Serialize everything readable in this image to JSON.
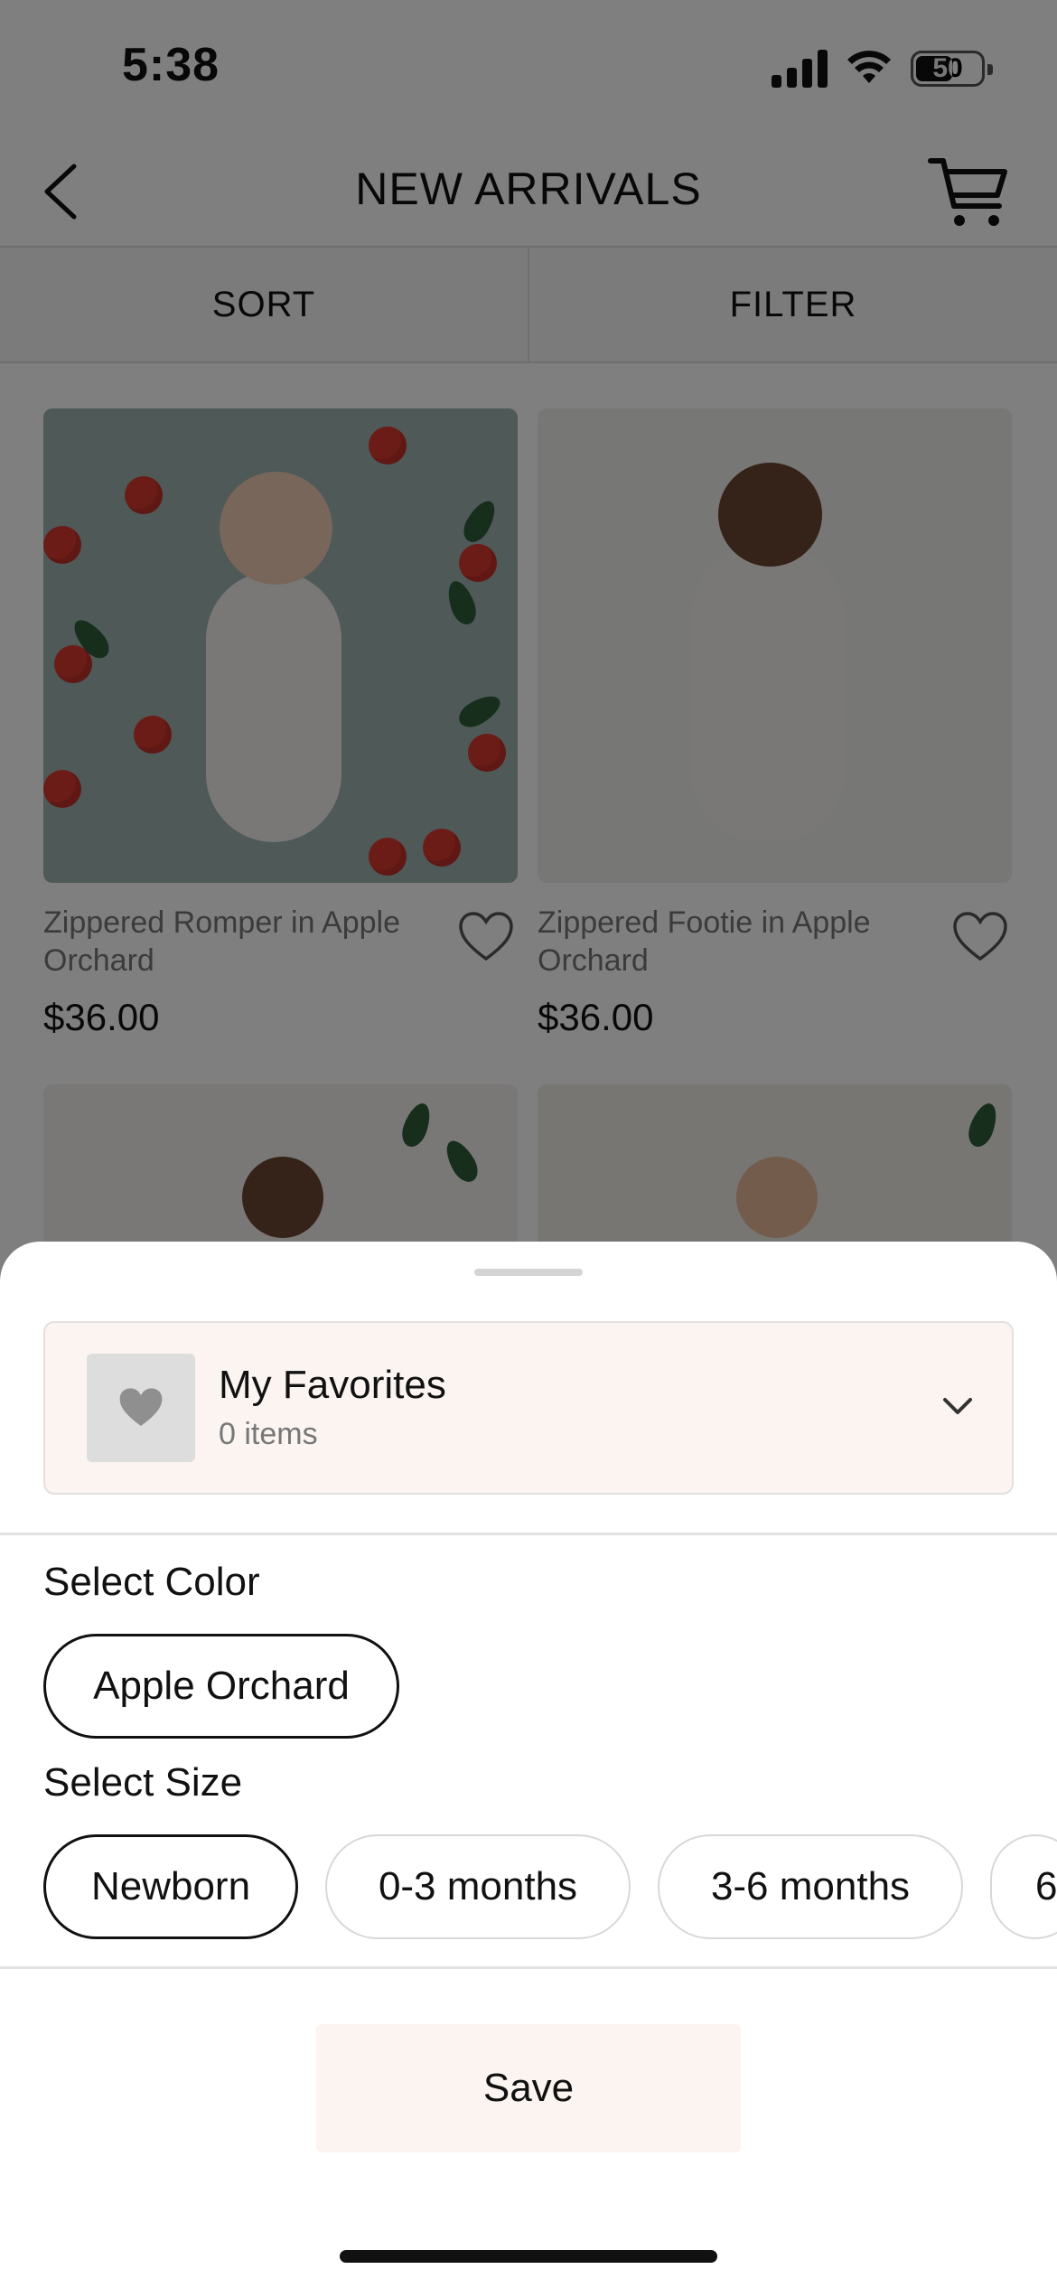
{
  "status_bar": {
    "time": "5:38",
    "battery": "50",
    "icons": [
      "signal-icon",
      "wifi-icon",
      "battery-icon"
    ]
  },
  "header": {
    "title": "NEW ARRIVALS",
    "back_icon": "back-chevron-icon",
    "cart_icon": "cart-icon"
  },
  "toolbar": {
    "sort_label": "SORT",
    "filter_label": "FILTER"
  },
  "products": [
    {
      "name": "Zippered Romper in Apple Orchard",
      "price": "$36.00",
      "favorite_icon": "heart-outline-icon"
    },
    {
      "name": "Zippered Footie in Apple Orchard",
      "price": "$36.00",
      "favorite_icon": "heart-outline-icon"
    }
  ],
  "sheet": {
    "favorites": {
      "title": "My Favorites",
      "count": "0 items",
      "thumb_icon": "heart-filled-icon",
      "dropdown_icon": "chevron-down-icon"
    },
    "select_color_label": "Select Color",
    "colors": [
      {
        "label": "Apple Orchard",
        "selected": true
      }
    ],
    "select_size_label": "Select Size",
    "sizes": [
      {
        "label": "Newborn",
        "selected": true
      },
      {
        "label": "0-3 months",
        "selected": false
      },
      {
        "label": "3-6 months",
        "selected": false
      },
      {
        "label": "6",
        "selected": false
      }
    ],
    "save_label": "Save"
  },
  "colors": {
    "sheet_background": "#ffffff",
    "accent_tint": "#fbf4f1",
    "scrim": "rgba(0,0,0,0.5)"
  }
}
